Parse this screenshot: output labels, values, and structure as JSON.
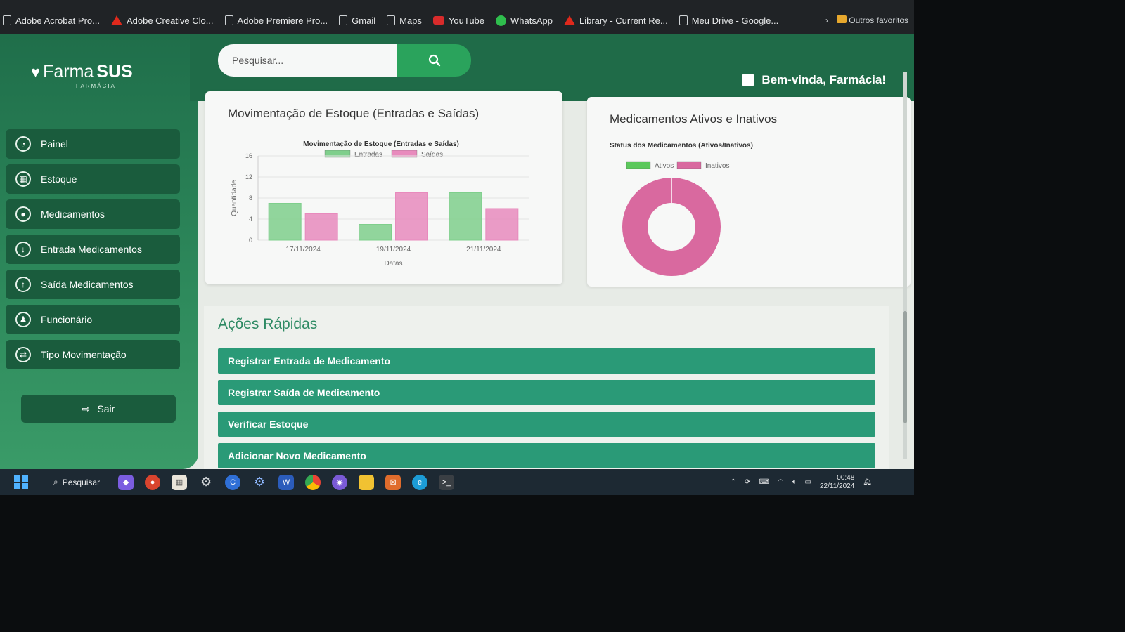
{
  "browser": {
    "bookmarks": [
      {
        "label": "Adobe Acrobat Pro...",
        "icon": "file-icon"
      },
      {
        "label": "Adobe Creative Clo...",
        "icon": "adobe-icon"
      },
      {
        "label": "Adobe Premiere Pro...",
        "icon": "file-icon"
      },
      {
        "label": "Gmail",
        "icon": "file-icon"
      },
      {
        "label": "Maps",
        "icon": "file-icon"
      },
      {
        "label": "YouTube",
        "icon": "youtube-icon"
      },
      {
        "label": "WhatsApp",
        "icon": "whatsapp-icon"
      },
      {
        "label": "Library - Current Re...",
        "icon": "library-icon"
      },
      {
        "label": "Meu Drive - Google...",
        "icon": "file-icon"
      }
    ],
    "other_favorites": "Outros favoritos"
  },
  "sidebar": {
    "logo_text": "Farma",
    "logo_bold": "SUS",
    "logo_sub": "FARMÁCIA",
    "items": [
      {
        "label": "Painel",
        "icon": "dashboard-icon"
      },
      {
        "label": "Estoque",
        "icon": "boxes-icon"
      },
      {
        "label": "Medicamentos",
        "icon": "pills-icon"
      },
      {
        "label": "Entrada Medicamentos",
        "icon": "arrow-down-circle-icon"
      },
      {
        "label": "Saída Medicamentos",
        "icon": "arrow-up-circle-icon"
      },
      {
        "label": "Funcionário",
        "icon": "users-icon"
      },
      {
        "label": "Tipo Movimentação",
        "icon": "exchange-icon"
      }
    ],
    "logout_label": "Sair"
  },
  "header": {
    "search_placeholder": "Pesquisar...",
    "welcome": "Bem-vinda, Farmácia!"
  },
  "stock_card": {
    "heading": "Movimentação de Estoque (Entradas e Saídas)"
  },
  "status_card": {
    "heading": "Medicamentos Ativos e Inativos"
  },
  "quick_actions": {
    "title": "Ações Rápidas",
    "buttons": [
      "Registrar Entrada de Medicamento",
      "Registrar Saída de Medicamento",
      "Verificar Estoque",
      "Adicionar Novo Medicamento"
    ]
  },
  "taskbar": {
    "search_label": "Pesquisar",
    "time": "00:48",
    "date": "22/11/2024"
  },
  "colors": {
    "primary_green": "#1f6b48",
    "entradas": "#7fcf8c",
    "saidas": "#e88bbd",
    "action_button": "#2a9a77"
  },
  "chart_data": [
    {
      "type": "bar",
      "title": "Movimentação de Estoque (Entradas e Saídas)",
      "xlabel": "Datas",
      "ylabel": "Quantidade",
      "categories": [
        "17/11/2024",
        "19/11/2024",
        "21/11/2024"
      ],
      "series": [
        {
          "name": "Entradas",
          "values": [
            7,
            3,
            9
          ],
          "color": "#7fcf8c"
        },
        {
          "name": "Saídas",
          "values": [
            5,
            9,
            6
          ],
          "color": "#e88bbd"
        }
      ],
      "ylim": [
        0,
        16
      ],
      "yticks": [
        0,
        4,
        8,
        12,
        16
      ],
      "legend": "top"
    },
    {
      "type": "pie",
      "title": "Status dos Medicamentos (Ativos/Inativos)",
      "labels": [
        "Ativos",
        "Inativos"
      ],
      "values": [
        0,
        1
      ],
      "colors": [
        "#5cc85c",
        "#d9699f"
      ],
      "legend": "top"
    }
  ]
}
